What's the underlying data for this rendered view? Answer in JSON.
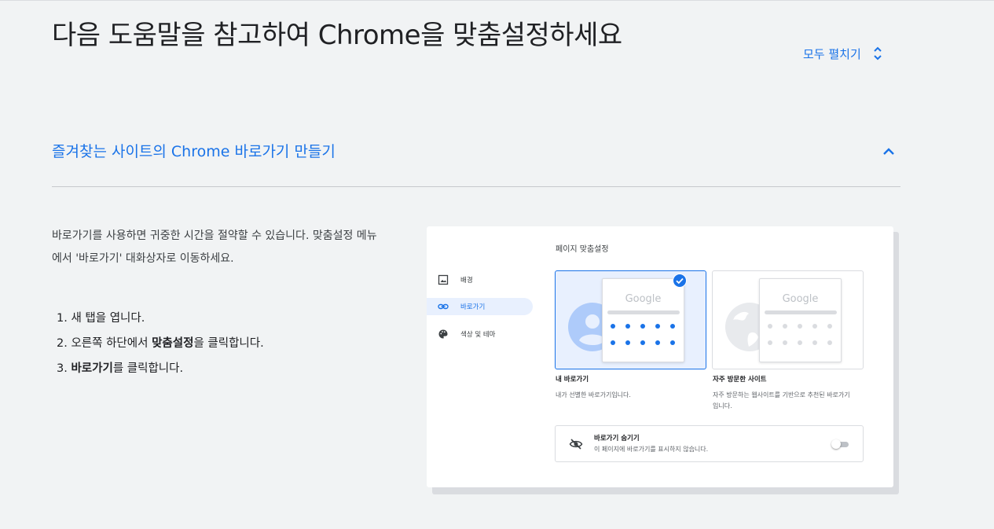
{
  "header": {
    "title": "다음 도움말을 참고하여 Chrome을 맞춤설정하세요",
    "expand_all_label": "모두 펼치기"
  },
  "section": {
    "title": "즐겨찾는 사이트의 Chrome 바로가기 만들기",
    "intro": "바로가기를 사용하면 귀중한 시간을 절약할 수 있습니다. 맞춤설정 메뉴에서 '바로가기' 대화상자로 이동하세요.",
    "steps": [
      {
        "num": "1.",
        "pre": "새 탭을 엽니다.",
        "bold": "",
        "post": ""
      },
      {
        "num": "2.",
        "pre": "오른쪽 하단에서 ",
        "bold": "맞춤설정",
        "post": "을 클릭합니다."
      },
      {
        "num": "3.",
        "pre": "",
        "bold": "바로가기",
        "post": "를 클릭합니다."
      }
    ]
  },
  "illustration": {
    "heading": "페이지 맞춤설정",
    "sidebar": [
      {
        "label": "배경",
        "icon": "image-icon",
        "active": false
      },
      {
        "label": "바로가기",
        "icon": "link-icon",
        "active": true
      },
      {
        "label": "색상 및 테마",
        "icon": "palette-icon",
        "active": false
      }
    ],
    "logo_text": "Google",
    "cards": [
      {
        "title": "내 바로가기",
        "desc": "내가 선별한 바로가기입니다.",
        "selected": true
      },
      {
        "title": "자주 방문한 사이트",
        "desc": "자주 방문하는 웹사이트를 기반으로 추천된 바로가기입니다.",
        "selected": false
      }
    ],
    "hide_option": {
      "title": "바로가기 숨기기",
      "desc": "이 페이지에 바로가기를 표시하지 않습니다.",
      "enabled": false
    }
  },
  "colors": {
    "accent": "#1a73e8",
    "background": "#f1f3f4",
    "selected_card_bg": "#e8f0fe",
    "inactive_dot": "#dadce0"
  }
}
